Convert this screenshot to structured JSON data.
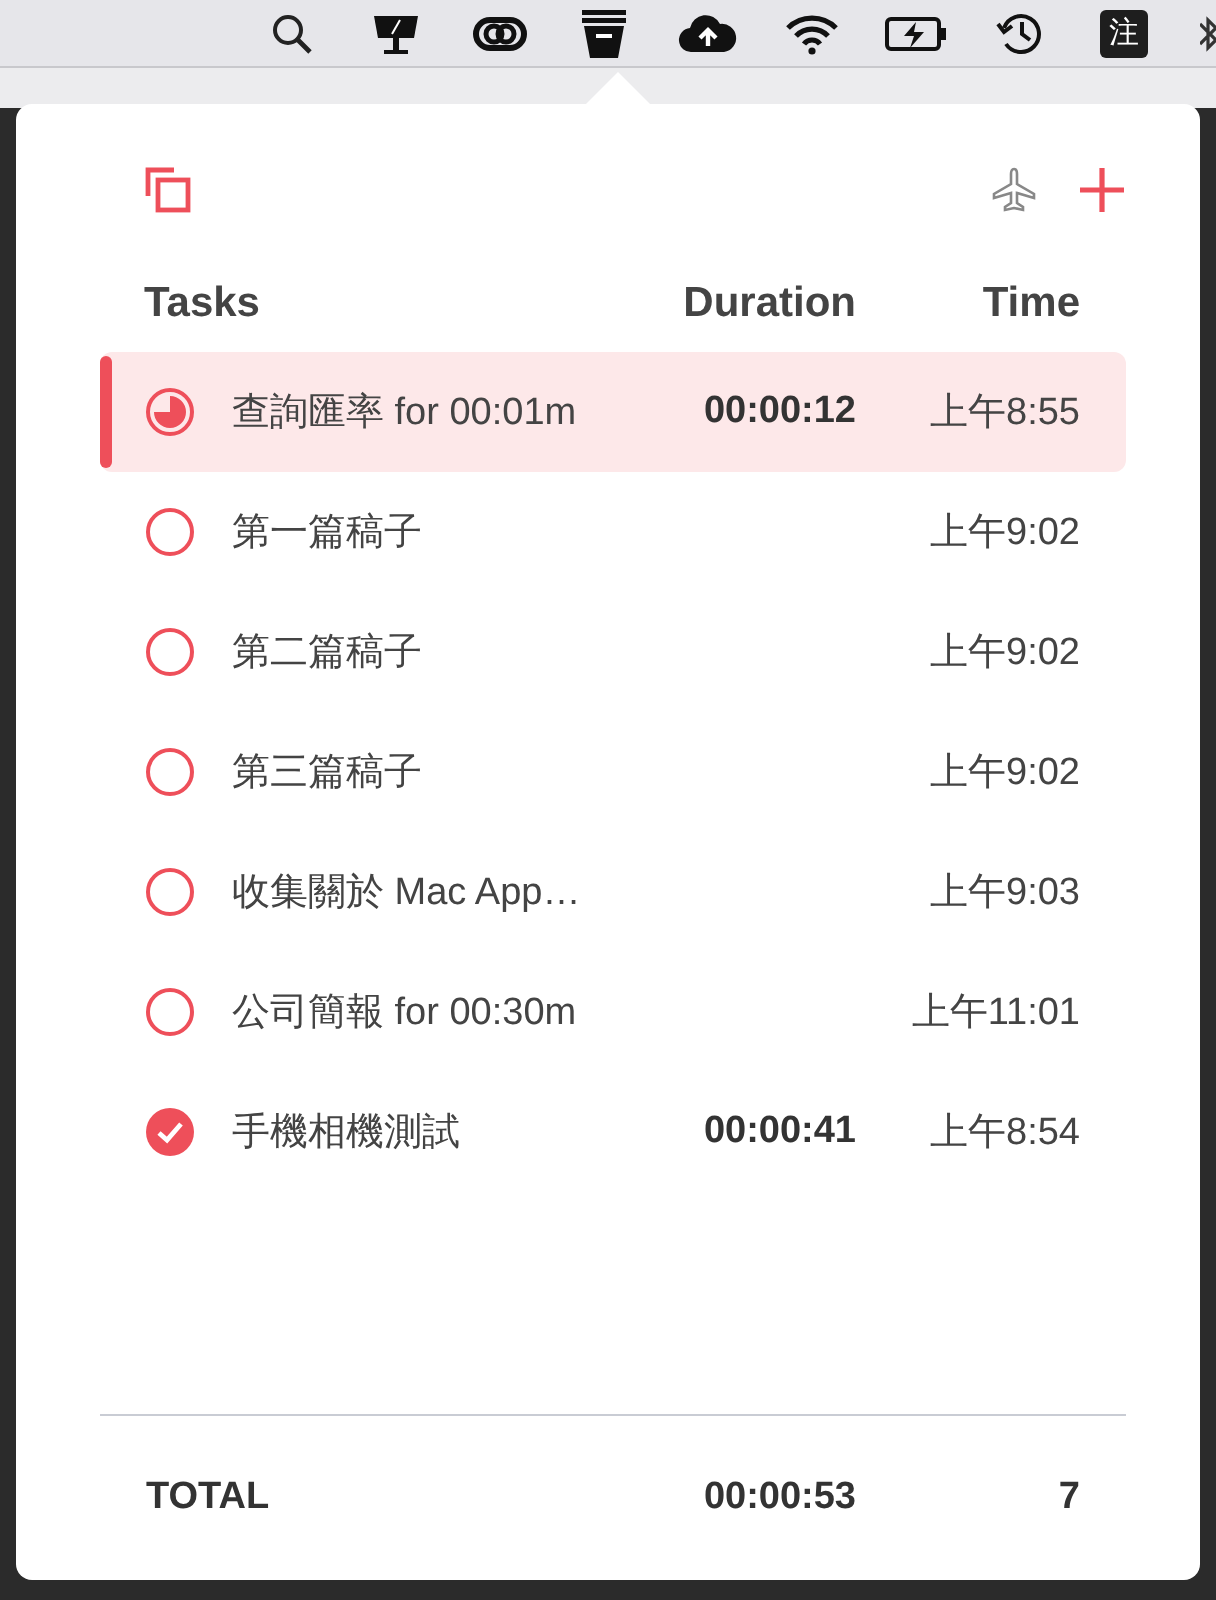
{
  "menu_bar": {
    "input_method": "注"
  },
  "header": {
    "columns": [
      "Tasks",
      "Duration",
      "Time"
    ]
  },
  "tasks": [
    {
      "kind": "running",
      "selected": true,
      "title": "查詢匯率 for 00:01m",
      "duration": "00:00:12",
      "time": "上午8:55"
    },
    {
      "kind": "open",
      "selected": false,
      "title": "第一篇稿子",
      "time": "上午9:02"
    },
    {
      "kind": "open",
      "selected": false,
      "title": "第二篇稿子",
      "time": "上午9:02"
    },
    {
      "kind": "open",
      "selected": false,
      "title": "第三篇稿子",
      "time": "上午9:02"
    },
    {
      "kind": "open",
      "selected": false,
      "title": "收集關於 Mac App…",
      "time": "上午9:03"
    },
    {
      "kind": "open",
      "selected": false,
      "title": "公司簡報 for 00:30m",
      "time": "上午11:01"
    },
    {
      "kind": "done",
      "selected": false,
      "title": "手機相機測試",
      "duration": "00:00:41",
      "time": "上午8:54"
    }
  ],
  "total": {
    "label": "TOTAL",
    "duration": "00:00:53",
    "count": "7"
  }
}
